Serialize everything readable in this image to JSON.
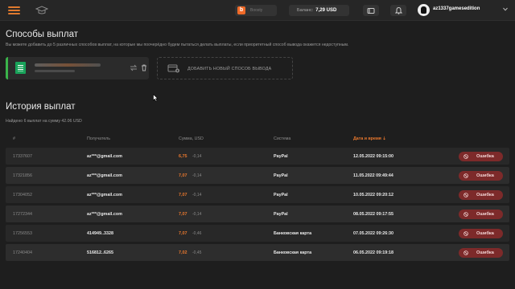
{
  "topbar": {
    "boosty_label": "Boosty",
    "balance_label": "Баланс:",
    "balance_value": "7,29 USD",
    "username": "az1337gamesedition"
  },
  "methods": {
    "title": "Способы выплат",
    "description": "Вы можете добавить до 5 различных способов выплат, на которые мы поочерёдно будем пытаться делать выплаты, если приоритетный способ вывода окажется недоступным.",
    "add_label": "ДОБАВИТЬ НОВЫЙ СПОСОБ ВЫВОДА"
  },
  "history": {
    "title": "История выплат",
    "summary": "Найдено 6 выплат на сумму 42.06 USD",
    "columns": [
      "#",
      "Получатель",
      "Сумма, USD",
      "Система",
      "Дата и время ⇣"
    ],
    "rows": [
      {
        "id": "17337607",
        "recipient": "az***@gmail.com",
        "amount": "6,75",
        "fee": "-0,14",
        "system": "PayPal",
        "datetime": "12.05.2022 09:15:00",
        "status": "Ошибка"
      },
      {
        "id": "17321856",
        "recipient": "az***@gmail.com",
        "amount": "7,07",
        "fee": "-0,14",
        "system": "PayPal",
        "datetime": "11.05.2022 09:49:44",
        "status": "Ошибка"
      },
      {
        "id": "17304052",
        "recipient": "az***@gmail.com",
        "amount": "7,07",
        "fee": "-0,14",
        "system": "PayPal",
        "datetime": "10.05.2022 09:20:12",
        "status": "Ошибка"
      },
      {
        "id": "17272344",
        "recipient": "az***@gmail.com",
        "amount": "7,07",
        "fee": "-0,14",
        "system": "PayPal",
        "datetime": "08.05.2022 09:17:55",
        "status": "Ошибка"
      },
      {
        "id": "17256553",
        "recipient": "414949..3328",
        "amount": "7,07",
        "fee": "-0,46",
        "system": "Банковская карта",
        "datetime": "07.05.2022 09:26:30",
        "status": "Ошибка"
      },
      {
        "id": "17240404",
        "recipient": "516812..6265",
        "amount": "7,02",
        "fee": "-0,45",
        "system": "Банковская карта",
        "datetime": "06.05.2022 09:19:18",
        "status": "Ошибка"
      }
    ]
  },
  "colors": {
    "accent": "#e9782e",
    "error_badge": "#7d2a2a",
    "sheet_green": "#19a35a"
  }
}
